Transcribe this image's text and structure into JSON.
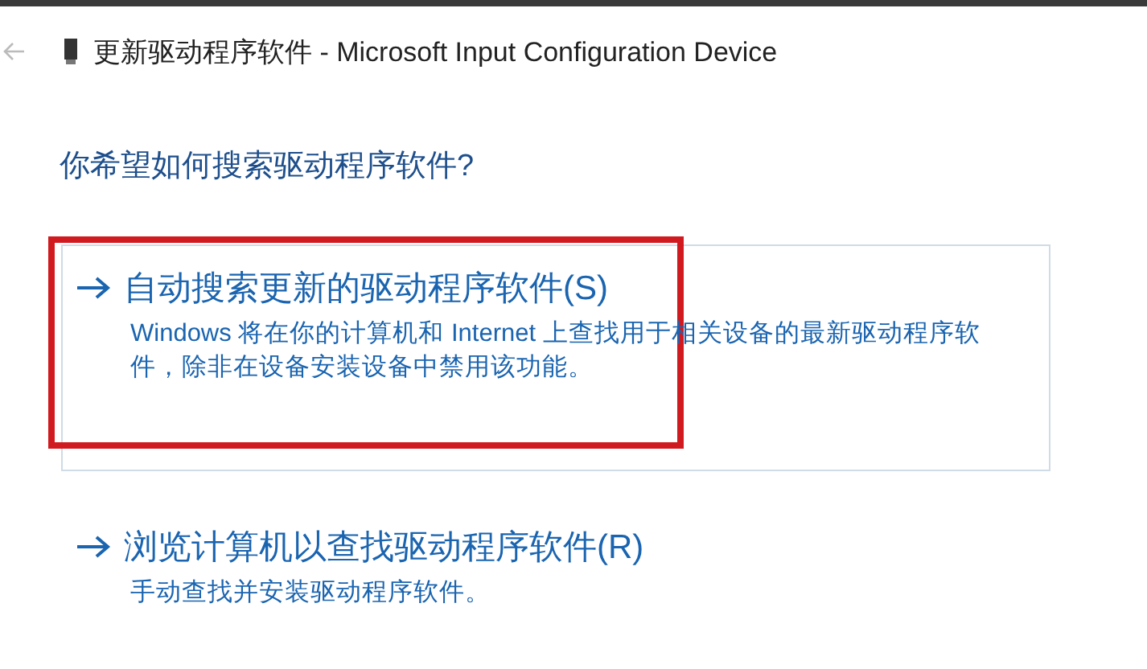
{
  "window": {
    "title": "更新驱动程序软件 - Microsoft Input Configuration Device"
  },
  "heading": "你希望如何搜索驱动程序软件?",
  "options": [
    {
      "title": "自动搜索更新的驱动程序软件(S)",
      "description": "Windows 将在你的计算机和 Internet 上查找用于相关设备的最新驱动程序软件，除非在设备安装设备中禁用该功能。",
      "focused": true,
      "annotated": true
    },
    {
      "title": "浏览计算机以查找驱动程序软件(R)",
      "description": "手动查找并安装驱动程序软件。",
      "focused": false,
      "annotated": false
    }
  ]
}
